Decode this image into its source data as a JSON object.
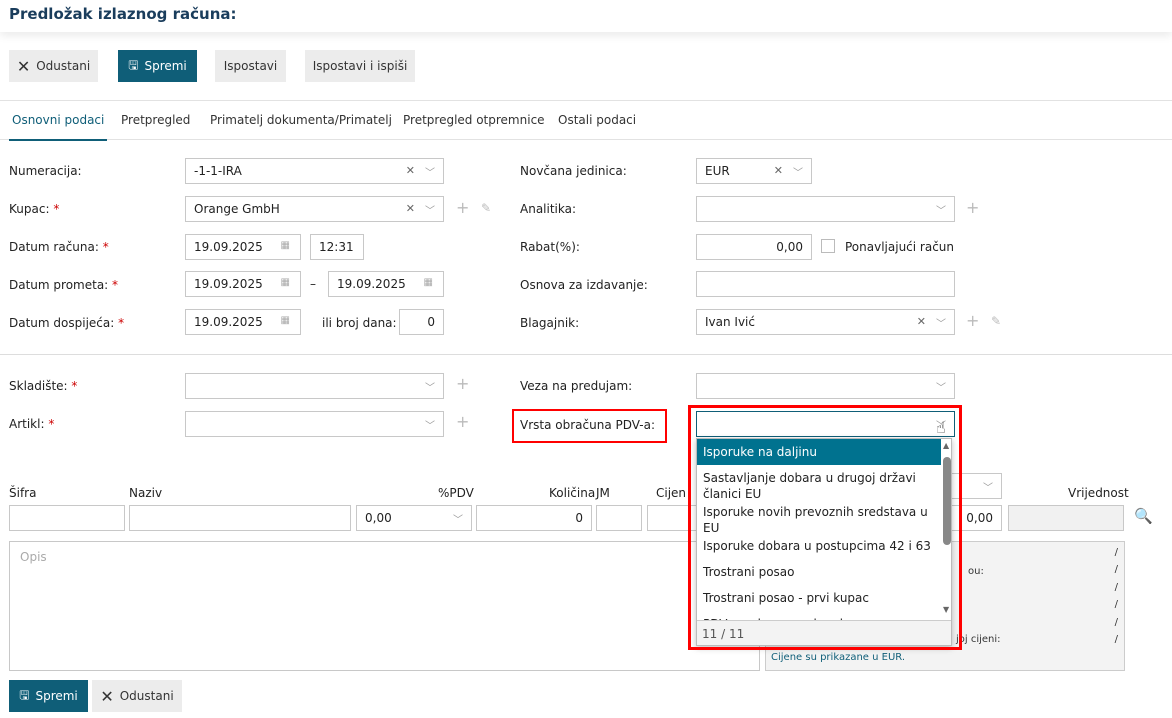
{
  "header": {
    "title": "Predložak izlaznog računa:"
  },
  "toolbar": {
    "cancel": "Odustani",
    "save": "Spremi",
    "issue": "Ispostavi",
    "issue_print": "Ispostavi i ispiši"
  },
  "tabs": [
    "Osnovni podaci",
    "Pretpregled",
    "Primatelj dokumenta/Primatelj",
    "Pretpregled otpremnice",
    "Ostali podaci"
  ],
  "form": {
    "numeracija": {
      "label": "Numeracija:",
      "value": "-1-1-IRA"
    },
    "kupac": {
      "label": "Kupac:",
      "value": "Orange GmbH"
    },
    "datum_racuna": {
      "label": "Datum računa:",
      "date": "19.09.2025",
      "time": "12:31"
    },
    "datum_prometa": {
      "label": "Datum prometa:",
      "from": "19.09.2025",
      "sep": "–",
      "to": "19.09.2025"
    },
    "datum_dospijeca": {
      "label": "Datum dospijeća:",
      "date": "19.09.2025",
      "days_label": "ili broj dana:",
      "days": "0"
    },
    "valuta": {
      "label": "Novčana jedinica:",
      "value": "EUR"
    },
    "analitika": {
      "label": "Analitika:",
      "value": ""
    },
    "rabat": {
      "label": "Rabat(%):",
      "value": "0,00",
      "recurring_label": "Ponavljajući račun"
    },
    "osnova": {
      "label": "Osnova za izdavanje:",
      "value": ""
    },
    "blagajnik": {
      "label": "Blagajnik:",
      "value": "Ivan Ivić"
    },
    "skladiste": {
      "label": "Skladište:"
    },
    "artikl": {
      "label": "Artikl:"
    },
    "veza": {
      "label": "Veza na predujam:"
    },
    "vrsta_pdv": {
      "label": "Vrsta obračuna PDV-a:"
    },
    "required_mark": "*"
  },
  "items": {
    "headers": {
      "sifra": "Šifra",
      "naziv": "Naziv",
      "pdv": "%PDV",
      "kolicina": "Količina",
      "jm": "JM",
      "cijena": "Cijen",
      "vrijednost": "Vrijednost"
    },
    "pdv_value": "0,00",
    "kolicina_value": "0",
    "rabat_value": "0,00",
    "opis_placeholder": "Opis"
  },
  "summary": {
    "fragments": [
      "ou:",
      "joj cijeni:"
    ],
    "slash": "/",
    "currency_note": "Cijene su prikazane u EUR."
  },
  "dropdown": {
    "options": [
      "Isporuke na daljinu",
      "Sastavljanje dobara u drugoj državi članici EU",
      "Isporuke novih prevoznih sredstava u EU",
      "Isporuke dobara u postupcima 42 i 63",
      "Trostrani posao",
      "Trostrani posao - prvi kupac",
      "PDV na ukupnu naknadu"
    ],
    "count": "11 / 11"
  },
  "bottom": {
    "save": "Spremi",
    "cancel": "Odustani"
  },
  "colors": {
    "primary": "#0f5e78",
    "highlight": "#00728f",
    "annotation": "#ff0000"
  }
}
